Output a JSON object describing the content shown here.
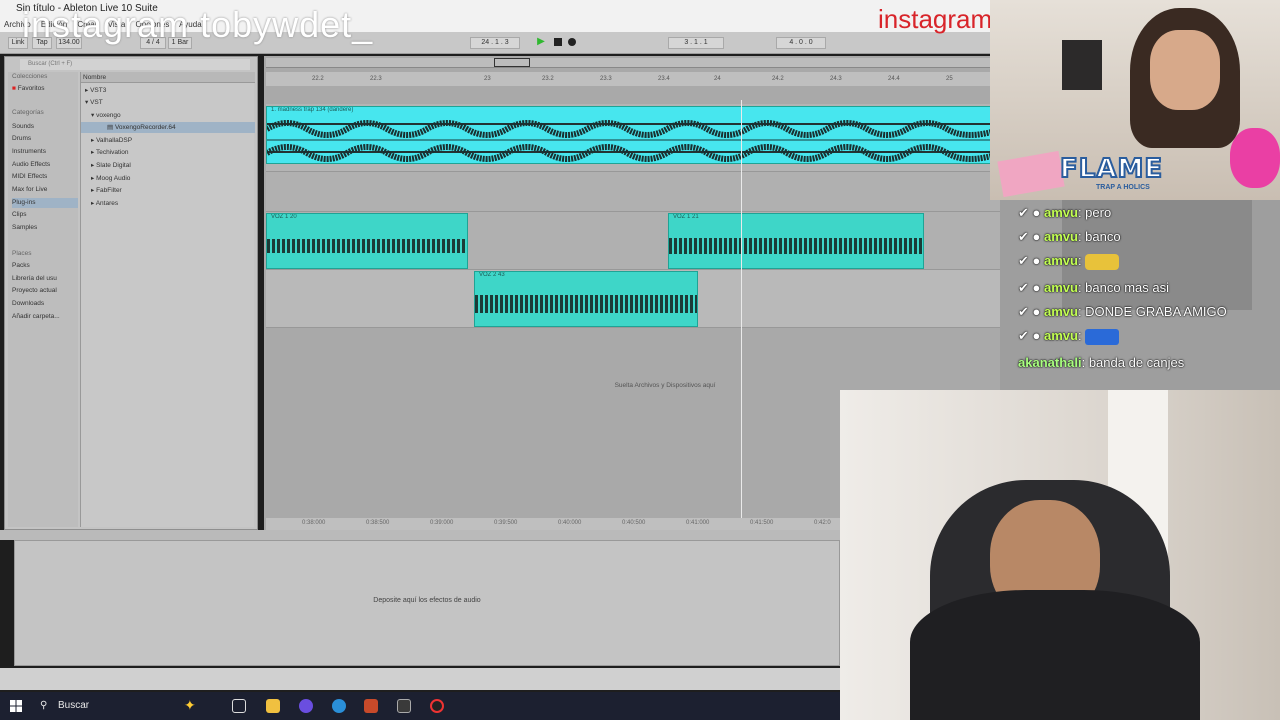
{
  "window": {
    "title": "Sin título - Ableton Live 10 Suite"
  },
  "menu": [
    "Archivo",
    "Edición",
    "Crear",
    "Vista",
    "Opciones",
    "Ayuda"
  ],
  "overlay": {
    "left": "instagram tobywdet_",
    "right": "instagram"
  },
  "control_bar": {
    "link": "Link",
    "tap": "Tap",
    "tempo": "134.00",
    "meter": "4 / 4",
    "quant": "1 Bar",
    "position": "24 . 1 . 3",
    "loop_start": "3 . 1 . 1",
    "loop_len": "4 . 0 . 0"
  },
  "browser": {
    "search_placeholder": "Buscar (Ctrl + F)",
    "collections_header": "Colecciones",
    "collections": [
      "Favoritos"
    ],
    "categories_header": "Categorías",
    "categories": [
      "Sounds",
      "Drums",
      "Instruments",
      "Audio Effects",
      "MIDI Effects",
      "Max for Live",
      "Plug-ins",
      "Clips",
      "Samples"
    ],
    "selected_category": "Plug-ins",
    "places_header": "Places",
    "places": [
      "Packs",
      "Librería del usu",
      "Proyecto actual",
      "Downloads",
      "Añadir carpeta..."
    ],
    "list_header": "Nombre",
    "items": [
      "VST3",
      "VST",
      "voxengo",
      "VoxengoRecorder.64",
      "ValhallaDSP",
      "Techivation",
      "Slate Digital",
      "Moog Audio",
      "FabFilter",
      "Antares"
    ],
    "selected_item": "VoxengoRecorder.64"
  },
  "arrangement": {
    "ruler": [
      "22.2",
      "22.3",
      "23",
      "23.2",
      "23.3",
      "23.4",
      "24",
      "24.2",
      "24.3",
      "24.4",
      "25"
    ],
    "time_ruler": [
      "0:38:000",
      "0:38:500",
      "0:39:000",
      "0:39:500",
      "0:40:000",
      "0:40:500",
      "0:41:000",
      "0:41:500",
      "0:42:0"
    ],
    "clips": {
      "beat": "1. madness trap 134 (dandere)",
      "voz1a": "VOZ 1 20",
      "voz1b": "VOZ 1 21",
      "voz2": "VOZ 2 43"
    },
    "drop_hint": "Suelta Archivos y Dispositivos aquí"
  },
  "detail": {
    "hint": "Deposite aquí los efectos de audio"
  },
  "taskbar": {
    "search": "Buscar"
  },
  "stream": {
    "banner": "FLAME",
    "banner_sub": "TRAP A HOLICS",
    "chat": [
      {
        "user": "amvu",
        "text": "pero"
      },
      {
        "user": "amvu",
        "text": "banco"
      },
      {
        "user": "amvu",
        "text": ""
      },
      {
        "user": "amvu",
        "text": "banco mas asi"
      },
      {
        "user": "amvu",
        "text": "DONDE GRABA AMIGO"
      },
      {
        "user": "amvu",
        "text": ""
      },
      {
        "user": "akanathali",
        "text": "banda de canjes"
      }
    ]
  },
  "colors": {
    "clip": "#3ed6c8",
    "clip_bright": "#47e6ee",
    "chat_user": "#c3ff54"
  }
}
